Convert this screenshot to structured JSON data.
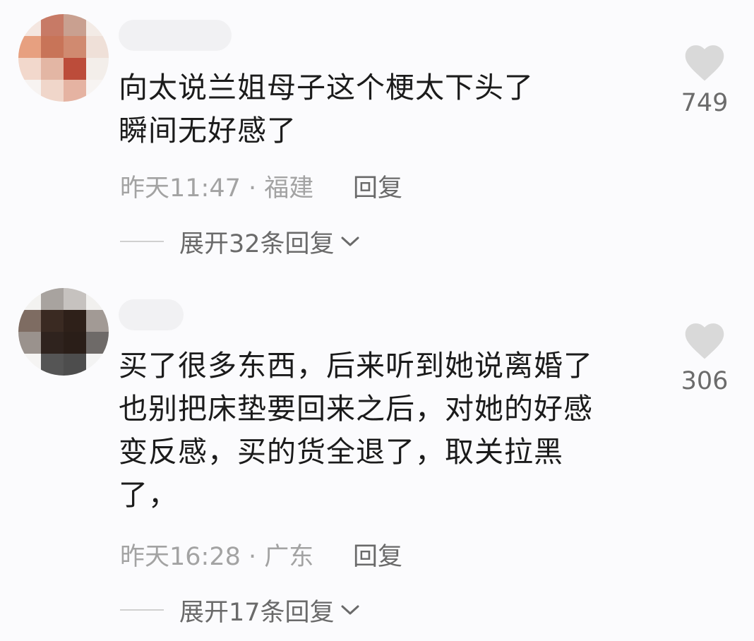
{
  "comments": [
    {
      "avatar_colors": [
        "#f4e6e0",
        "#c77a66",
        "#c9a090",
        "#f3ebe6",
        "#e7a080",
        "#c87458",
        "#d08a70",
        "#efe0d8",
        "#f2d8cc",
        "#e3b6a4",
        "#bc4c3a",
        "#f3eeea",
        "#f7f3f1",
        "#f0d6ca",
        "#e5b3a2",
        "#f7f4f2"
      ],
      "lines": [
        "向太说兰姐母子这个梗太下头了",
        "瞬间无好感了"
      ],
      "time": "昨天11:47",
      "separator": " · ",
      "location": "福建",
      "reply_label": "回复",
      "likes": "749",
      "expand_label": "展开32条回复"
    },
    {
      "avatar_colors": [
        "#f3f2f0",
        "#a8a39f",
        "#c6c2bf",
        "#f1f0ee",
        "#7e6c62",
        "#3a2a22",
        "#2e2019",
        "#a29a95",
        "#9a928d",
        "#2f231e",
        "#2a1e18",
        "#6e6a68",
        "#f5f4f3",
        "#555555",
        "#4d4d4d",
        "#f3f3f3"
      ],
      "lines": [
        "买了很多东西，后来听到她说离婚了",
        "也别把床垫要回来之后，对她的好感",
        "变反感，买的货全退了，取关拉黑",
        "了，"
      ],
      "time": "昨天16:28",
      "separator": " · ",
      "location": "广东",
      "reply_label": "回复",
      "likes": "306",
      "expand_label": "展开17条回复"
    }
  ],
  "colors": {
    "background": "#fbfbfd",
    "text": "#1b1b1b",
    "meta": "#a3a3a3",
    "heart": "#d9d9d9"
  },
  "icons": {
    "like": "heart-icon",
    "expand": "chevron-down-icon"
  }
}
